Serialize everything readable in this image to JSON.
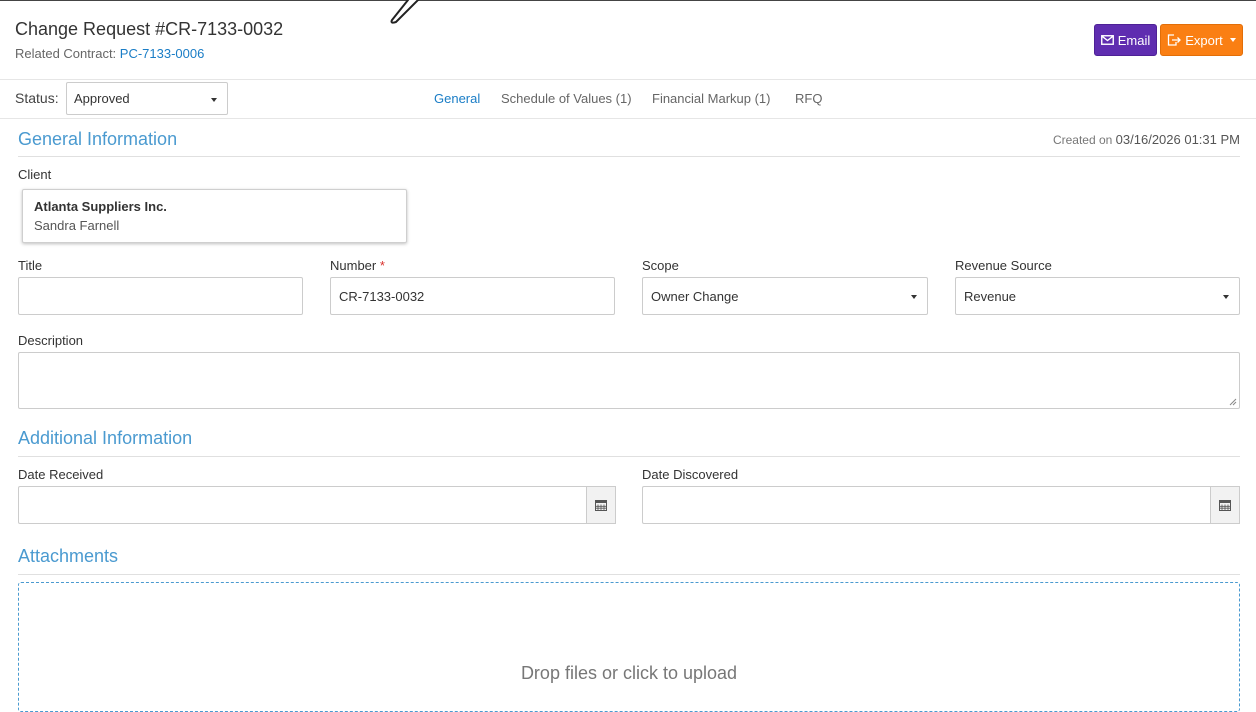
{
  "header": {
    "title": "Change Request #CR-7133-0032",
    "related_label": "Related Contract:",
    "related_link": "PC-7133-0006",
    "email_label": "Email",
    "export_label": "Export"
  },
  "status": {
    "label": "Status:",
    "value": "Approved"
  },
  "tabs": [
    {
      "label": "General",
      "active": true
    },
    {
      "label": "Schedule of Values (1)",
      "active": false
    },
    {
      "label": "Financial Markup (1)",
      "active": false
    },
    {
      "label": "RFQ",
      "active": false
    }
  ],
  "general": {
    "section_title": "General Information",
    "created_prefix": "Created on",
    "created_value": "03/16/2026 01:31 PM",
    "client_label": "Client",
    "client_name": "Atlanta Suppliers Inc.",
    "client_contact": "Sandra Farnell",
    "title_label": "Title",
    "title_value": "",
    "number_label": "Number",
    "number_required": "*",
    "number_value": "CR-7133-0032",
    "scope_label": "Scope",
    "scope_value": "Owner Change",
    "revenue_label": "Revenue Source",
    "revenue_value": "Revenue",
    "description_label": "Description",
    "description_value": ""
  },
  "additional": {
    "section_title": "Additional Information",
    "date_received_label": "Date Received",
    "date_received_value": "",
    "date_discovered_label": "Date Discovered",
    "date_discovered_value": ""
  },
  "attachments": {
    "section_title": "Attachments",
    "dropzone_text": "Drop files or click to upload"
  },
  "colors": {
    "accent": "#1a7dc6",
    "section_title": "#4a9ad0",
    "email_button": "#5f2db0",
    "export_button": "#fa7f13",
    "required": "#d9302c"
  },
  "icons": {
    "email": "envelope-icon",
    "export": "export-icon",
    "date": "calendar-icon",
    "dropdown": "caret-down-icon"
  }
}
